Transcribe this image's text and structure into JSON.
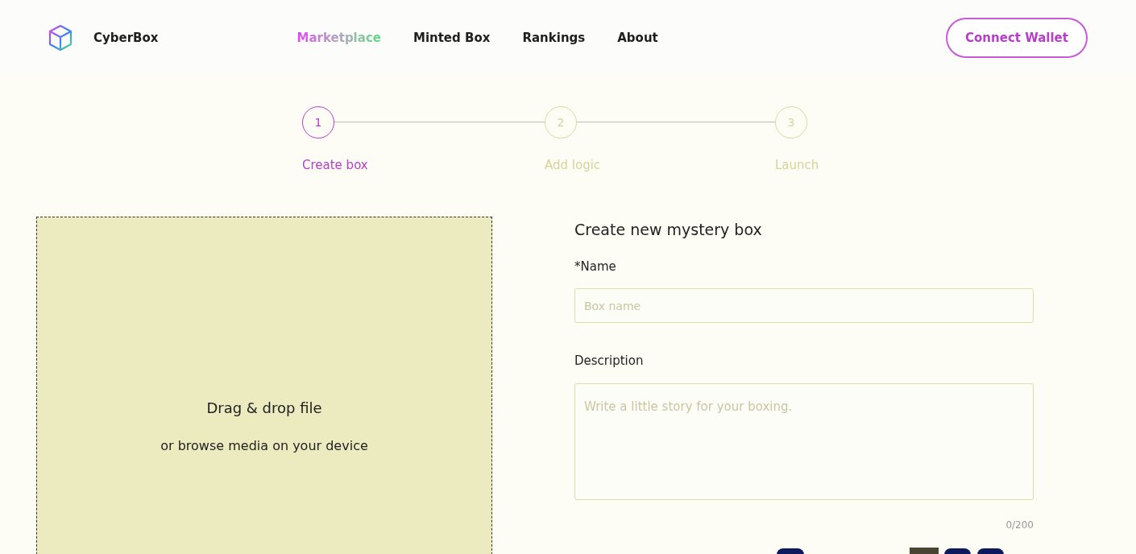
{
  "header": {
    "brand": "CyberBox",
    "nav": [
      {
        "label": "Marketplace",
        "selected": true
      },
      {
        "label": "Minted Box",
        "selected": false
      },
      {
        "label": "Rankings",
        "selected": false
      },
      {
        "label": "About",
        "selected": false
      }
    ],
    "connect_button": "Connect Wallet"
  },
  "steps": [
    {
      "number": "1",
      "label": "Create box",
      "selected": true
    },
    {
      "number": "2",
      "label": "Add logic",
      "selected": false
    },
    {
      "number": "3",
      "label": "Launch",
      "selected": false
    }
  ],
  "dropzone": {
    "title": "Drag & drop file",
    "subtitle": "or browse media on your device"
  },
  "form": {
    "title": "Create new mystery box",
    "name_label": "*Name",
    "name_placeholder": "Box name",
    "description_label": "Description",
    "description_placeholder": "Write a little story for your boxing.",
    "counter": "0/200"
  }
}
